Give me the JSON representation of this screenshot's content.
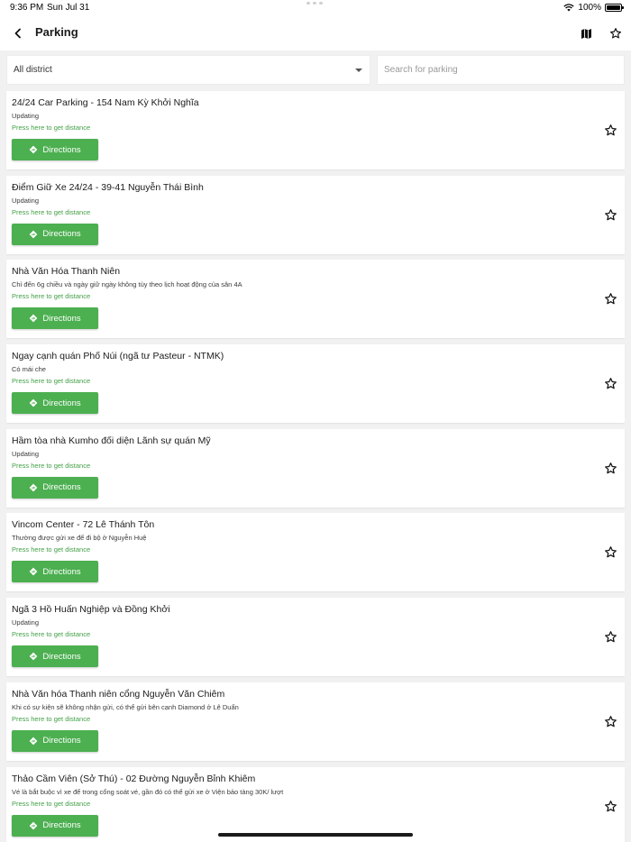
{
  "status_bar": {
    "time": "9:36 PM",
    "date": "Sun Jul 31",
    "battery": "100%"
  },
  "app_bar": {
    "title": "Parking"
  },
  "filters": {
    "district": "All district",
    "search_placeholder": "Search for parking"
  },
  "colors": {
    "accent": "#4caf50",
    "distance_text": "#43a047"
  },
  "icons": {
    "back": "back-arrow-icon",
    "map": "map-icon",
    "favorite": "star-outline-icon",
    "directions": "directions-diamond-icon"
  },
  "places": [
    {
      "title": "24/24 Car Parking - 154 Nam Kỳ Khởi Nghĩa",
      "description": "Updating",
      "distance": "Press here to get distance",
      "button": "Directions"
    },
    {
      "title": "Điểm Giữ Xe 24/24 - 39-41 Nguyễn Thái Bình",
      "description": "Updating",
      "distance": "Press here to get distance",
      "button": "Directions"
    },
    {
      "title": "Nhà Văn Hóa Thanh Niên",
      "description": "Chỉ đến 6g chiều và ngày giữ ngày không tùy theo lịch hoạt động của sân 4A",
      "distance": "Press here to get distance",
      "button": "Directions"
    },
    {
      "title": "Ngay cạnh quán Phố Núi (ngã tư Pasteur - NTMK)",
      "description": "Có mái che",
      "distance": "Press here to get distance",
      "button": "Directions"
    },
    {
      "title": "Hầm tòa nhà Kumho đối diện Lãnh sự quán Mỹ",
      "description": "Updating",
      "distance": "Press here to get distance",
      "button": "Directions"
    },
    {
      "title": "Vincom Center - 72 Lê Thánh Tôn",
      "description": "Thường được gửi xe để đi bộ ở Nguyễn Huệ",
      "distance": "Press here to get distance",
      "button": "Directions"
    },
    {
      "title": "Ngã 3 Hồ Huấn Nghiệp và Đồng Khởi",
      "description": "Updating",
      "distance": "Press here to get distance",
      "button": "Directions"
    },
    {
      "title": "Nhà Văn hóa Thanh niên cổng Nguyễn Văn Chiêm",
      "description": "Khi có sự kiện sẽ không nhận gửi, có thể gửi bên cạnh Diamond ở Lê Duẩn",
      "distance": "Press here to get distance",
      "button": "Directions"
    },
    {
      "title": "Thảo Cầm Viên (Sở Thú) - 02 Đường Nguyễn Bỉnh Khiêm",
      "description": "Vé là bắt buộc vì xe để trong cổng soát vé, gần đó có thể gửi xe ở Viện bảo tàng 30K/ lượt",
      "distance": "Press here to get distance",
      "button": "Directions"
    }
  ]
}
